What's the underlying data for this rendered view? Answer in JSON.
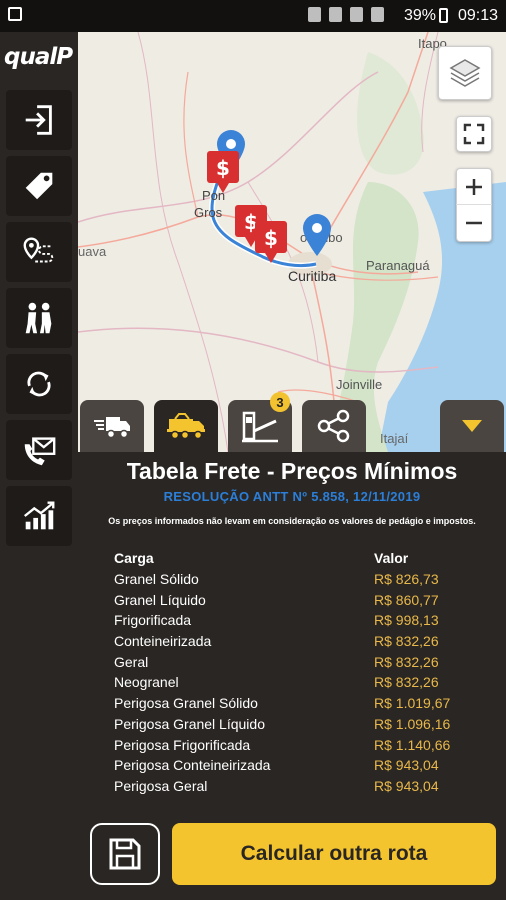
{
  "status_bar": {
    "battery": "39%",
    "time": "09:13"
  },
  "app": {
    "logo": "qualP"
  },
  "sidebar": {
    "items": [
      {
        "icon": "login-icon"
      },
      {
        "icon": "tag-icon"
      },
      {
        "icon": "route-icon"
      },
      {
        "icon": "people-icon"
      },
      {
        "icon": "refresh-icon"
      },
      {
        "icon": "contact-icon"
      },
      {
        "icon": "chart-icon"
      }
    ]
  },
  "map": {
    "labels": {
      "itapo": "Itapo",
      "ponta": "Pon",
      "grossa": "Gros",
      "curitiba": "Curitiba",
      "colombo": "olombo",
      "paranagua": "Paranaguá",
      "joinville": "Joinville",
      "itajai": "Itajaí",
      "guava": "uava"
    }
  },
  "tabs": {
    "items": [
      {
        "icon": "truck-icon",
        "active": false
      },
      {
        "icon": "freight-truck-icon",
        "active": true
      },
      {
        "icon": "toll-icon",
        "active": false,
        "badge": "3"
      },
      {
        "icon": "share-icon",
        "active": false
      }
    ]
  },
  "panel": {
    "title": "Tabela Frete - Preços Mínimos",
    "subtitle": "RESOLUÇÃO ANTT Nº 5.858, 12/11/2019",
    "note": "Os preços informados não levam em consideração os valores de pedágio e impostos.",
    "table": {
      "headers": {
        "carga": "Carga",
        "valor": "Valor"
      },
      "rows": [
        {
          "carga": "Granel Sólido",
          "valor": "R$ 826,73"
        },
        {
          "carga": "Granel Líquido",
          "valor": "R$ 860,77"
        },
        {
          "carga": "Frigorificada",
          "valor": "R$ 998,13"
        },
        {
          "carga": "Conteineirizada",
          "valor": "R$ 832,26"
        },
        {
          "carga": "Geral",
          "valor": "R$ 832,26"
        },
        {
          "carga": "Neogranel",
          "valor": "R$ 832,26"
        },
        {
          "carga": "Perigosa Granel Sólido",
          "valor": "R$ 1.019,67"
        },
        {
          "carga": "Perigosa Granel Líquido",
          "valor": "R$ 1.096,16"
        },
        {
          "carga": "Perigosa Frigorificada",
          "valor": "R$ 1.140,66"
        },
        {
          "carga": "Perigosa Conteineirizada",
          "valor": "R$ 943,04"
        },
        {
          "carga": "Perigosa Geral",
          "valor": "R$ 943,04"
        }
      ]
    },
    "calc_button": "Calcular outra rota"
  },
  "colors": {
    "accent": "#f3c42e",
    "price": "#e8b84a",
    "link": "#2b7fd8",
    "background": "#2a2623"
  }
}
